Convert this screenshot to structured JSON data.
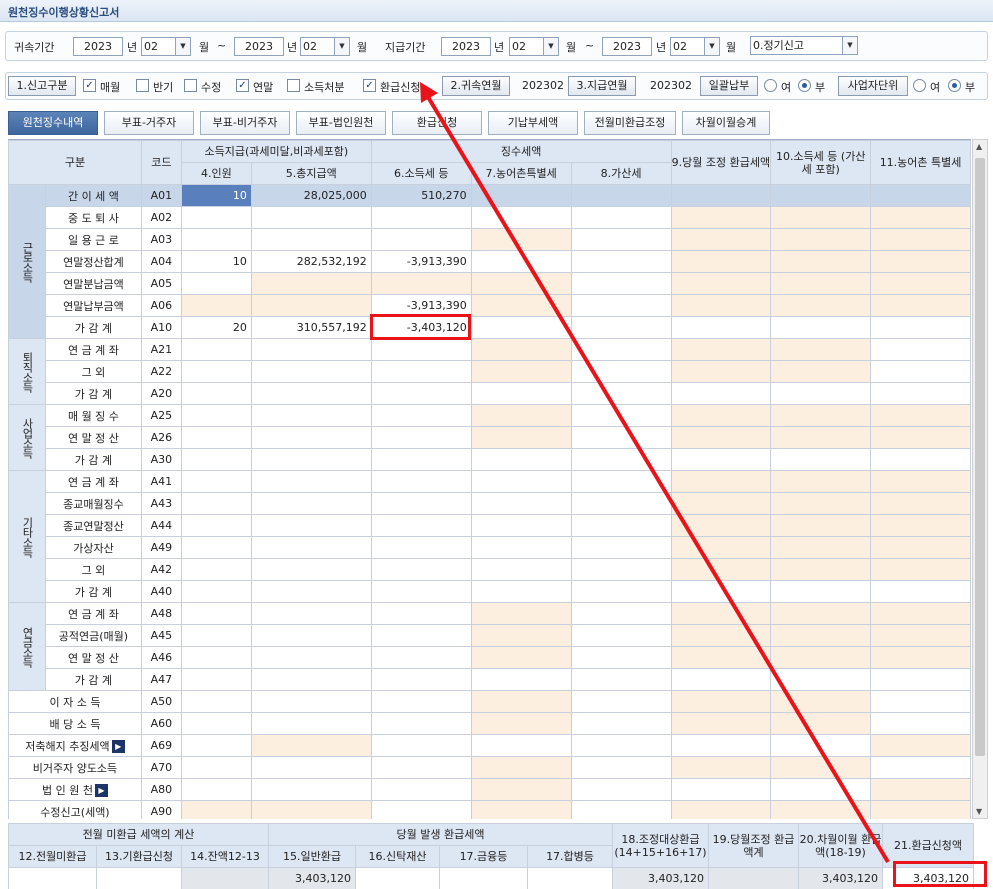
{
  "window": {
    "title": "원천징수이행상황신고서"
  },
  "period": {
    "label": "귀속기간",
    "y1": "2023",
    "yunit1": "년",
    "m1": "02",
    "munit1": "월",
    "tilde": "~",
    "y2": "2023",
    "yunit2": "년",
    "m2": "02",
    "munit2": "월",
    "pay_label": "지급기간",
    "py1": "2023",
    "pyunit1": "년",
    "pm1": "02",
    "pmunit1": "월",
    "ptilde": "~",
    "py2": "2023",
    "pyunit2": "년",
    "pm2": "02",
    "pmunit2": "월",
    "report_type": "0.정기신고"
  },
  "options": {
    "report_cat_btn": "1.신고구분",
    "monthly": "매월",
    "half": "반기",
    "amend": "수정",
    "yearend": "연말",
    "income_disp": "소득처분",
    "refund": "환급신청",
    "belong_btn": "2.귀속연월",
    "belong_val": "202302",
    "pay_btn": "3.지급연월",
    "pay_val": "202302",
    "lump_btn": "일괄납부",
    "yes": "여",
    "no": "부",
    "biz_btn": "사업자단위",
    "yes2": "여",
    "no2": "부"
  },
  "tabs": [
    "원천징수내역",
    "부표-거주자",
    "부표-비거주자",
    "부표-법인원천",
    "환급신청",
    "기납부세액",
    "전월미환급조정",
    "차월이월승계"
  ],
  "grid": {
    "h_gubun": "구분",
    "h_code": "코드",
    "h_pay": "소득지급(과세미달,비과세포함)",
    "h_tax": "징수세액",
    "h4": "4.인원",
    "h5": "5.총지급액",
    "h6": "6.소득세 등",
    "h7": "7.농어촌특별세",
    "h8": "8.가산세",
    "h9": "9.당월 조정 환급세액",
    "h10": "10.소득세 등 (가산세 포함)",
    "h11": "11.농어촌 특별세",
    "sections": {
      "labor": "근로소득",
      "retire": "퇴직소득",
      "biz": "사업소득",
      "other": "기타소득",
      "pension": "연금소득"
    },
    "rows": [
      {
        "label": "간 이 세 액",
        "code": "A01",
        "c4": "10",
        "c5": "28,025,000",
        "c6": "510,270"
      },
      {
        "label": "중 도 퇴 사",
        "code": "A02"
      },
      {
        "label": "일 용 근 로",
        "code": "A03"
      },
      {
        "label": "연말정산합계",
        "code": "A04",
        "c4": "10",
        "c5": "282,532,192",
        "c6": "-3,913,390"
      },
      {
        "label": "연말분납금액",
        "code": "A05"
      },
      {
        "label": "연말납부금액",
        "code": "A06",
        "c6": "-3,913,390"
      },
      {
        "label": "가 감 계",
        "code": "A10",
        "c4": "20",
        "c5": "310,557,192",
        "c6": "-3,403,120"
      },
      {
        "label": "연 금 계 좌",
        "code": "A21"
      },
      {
        "label": "그 외",
        "code": "A22"
      },
      {
        "label": "가 감 계",
        "code": "A20"
      },
      {
        "label": "매 월 징 수",
        "code": "A25"
      },
      {
        "label": "연 말 정 산",
        "code": "A26"
      },
      {
        "label": "가 감 계",
        "code": "A30"
      },
      {
        "label": "연 금 계 좌",
        "code": "A41"
      },
      {
        "label": "종교매월징수",
        "code": "A43"
      },
      {
        "label": "종교연말정산",
        "code": "A44"
      },
      {
        "label": "가상자산",
        "code": "A49"
      },
      {
        "label": "그 외",
        "code": "A42"
      },
      {
        "label": "가 감 계",
        "code": "A40"
      },
      {
        "label": "연 금 계 좌",
        "code": "A48"
      },
      {
        "label": "공적연금(매월)",
        "code": "A45"
      },
      {
        "label": "연 말 정 산",
        "code": "A46"
      },
      {
        "label": "가 감 계",
        "code": "A47"
      },
      {
        "label": "이 자 소 득",
        "code": "A50"
      },
      {
        "label": "배 당 소 득",
        "code": "A60"
      },
      {
        "label": "저축해지 추징세액",
        "code": "A69"
      },
      {
        "label": "비거주자 양도소득",
        "code": "A70"
      },
      {
        "label": "법 인 원 천",
        "code": "A80"
      },
      {
        "label": "수정신고(세액)",
        "code": "A90"
      }
    ]
  },
  "bottom": {
    "h_prev": "전월 미환급 세액의 계산",
    "h_cur": "당월 발생 환급세액",
    "h18": "18.조정대상환급 (14+15+16+17)",
    "h19": "19.당월조정 환급액계",
    "h20": "20.차월이월 환급액(18-19)",
    "h21": "21.환급신청액",
    "h12": "12.전월미환급",
    "h13": "13.기환급신청",
    "h14": "14.잔액12-13",
    "h15": "15.일반환급",
    "h16": "16.신탁재산",
    "h17": "17.금융등",
    "h17b": "17.합병등",
    "v15": "3,403,120",
    "v18": "3,403,120",
    "v20": "3,403,120",
    "v21": "3,403,120"
  },
  "colors": {
    "accent": "#e8141a",
    "header": "#dde6f3",
    "peach": "#fcefe0"
  }
}
